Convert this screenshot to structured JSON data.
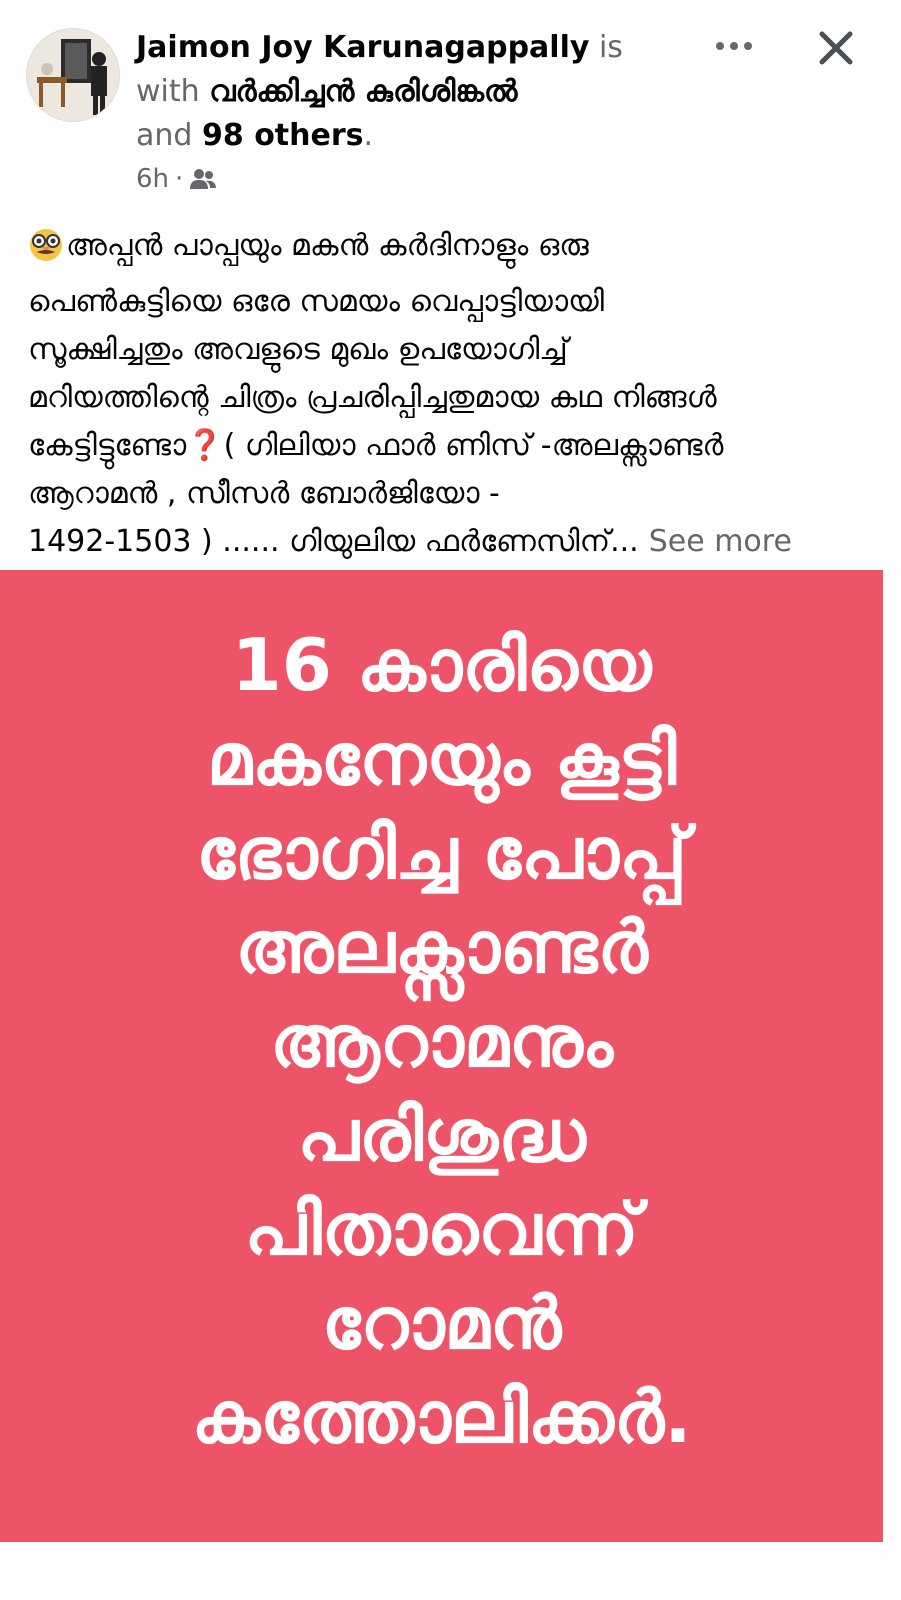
{
  "post": {
    "author": "Jaimon Joy Karunagappally",
    "is_label": "is",
    "with_label": "with",
    "tagged_name": "വർക്കിച്ചൻ കുരിശിങ്കൽ",
    "and_label": "and",
    "others": "98 others",
    "period": ".",
    "time": "6h",
    "dot": "·",
    "audience_icon": "friends-icon",
    "more_icon": "more-horizontal-icon",
    "close_icon": "close-icon"
  },
  "body": {
    "emoji": "disguised-face",
    "lines": [
      "അപ്പൻ പാപ്പയും മകൻ കർദിനാളും ഒരു",
      "പെൺകുട്ടിയെ ഒരേ സമയം വെപ്പാട്ടിയായി",
      "സൂക്ഷിച്ചതും അവളുടെ മുഖം ഉപയോഗിച്ച്",
      "മറിയത്തിന്റെ ചിത്രം പ്രചരിപ്പിച്ചതുമായ കഥ നിങ്ങൾ",
      "കേട്ടിട്ടുണ്ടോ",
      "( ഗിലിയാ ഫാർ ണിസ് -അലക്സാണ്ടർ",
      "ആറാമൻ , സീസർ ബോർജിയോ -",
      " 1492-1503 ) ...... ഗിയുലിയ ഫർണേസിന്..."
    ],
    "question_mark": "❓",
    "see_more": "See more"
  },
  "image_card": {
    "background": "#ee5468",
    "lines": [
      "16 കാരിയെ",
      "മകനേയും കൂട്ടി",
      "ഭോഗിച്ച പോപ്പ്",
      "അലക്സാണ്ടർ",
      "ആറാമനും",
      "പരിശുദ്ധ",
      "പിതാവെന്ന്",
      "റോമൻ",
      "കത്തോലിക്കർ."
    ]
  }
}
